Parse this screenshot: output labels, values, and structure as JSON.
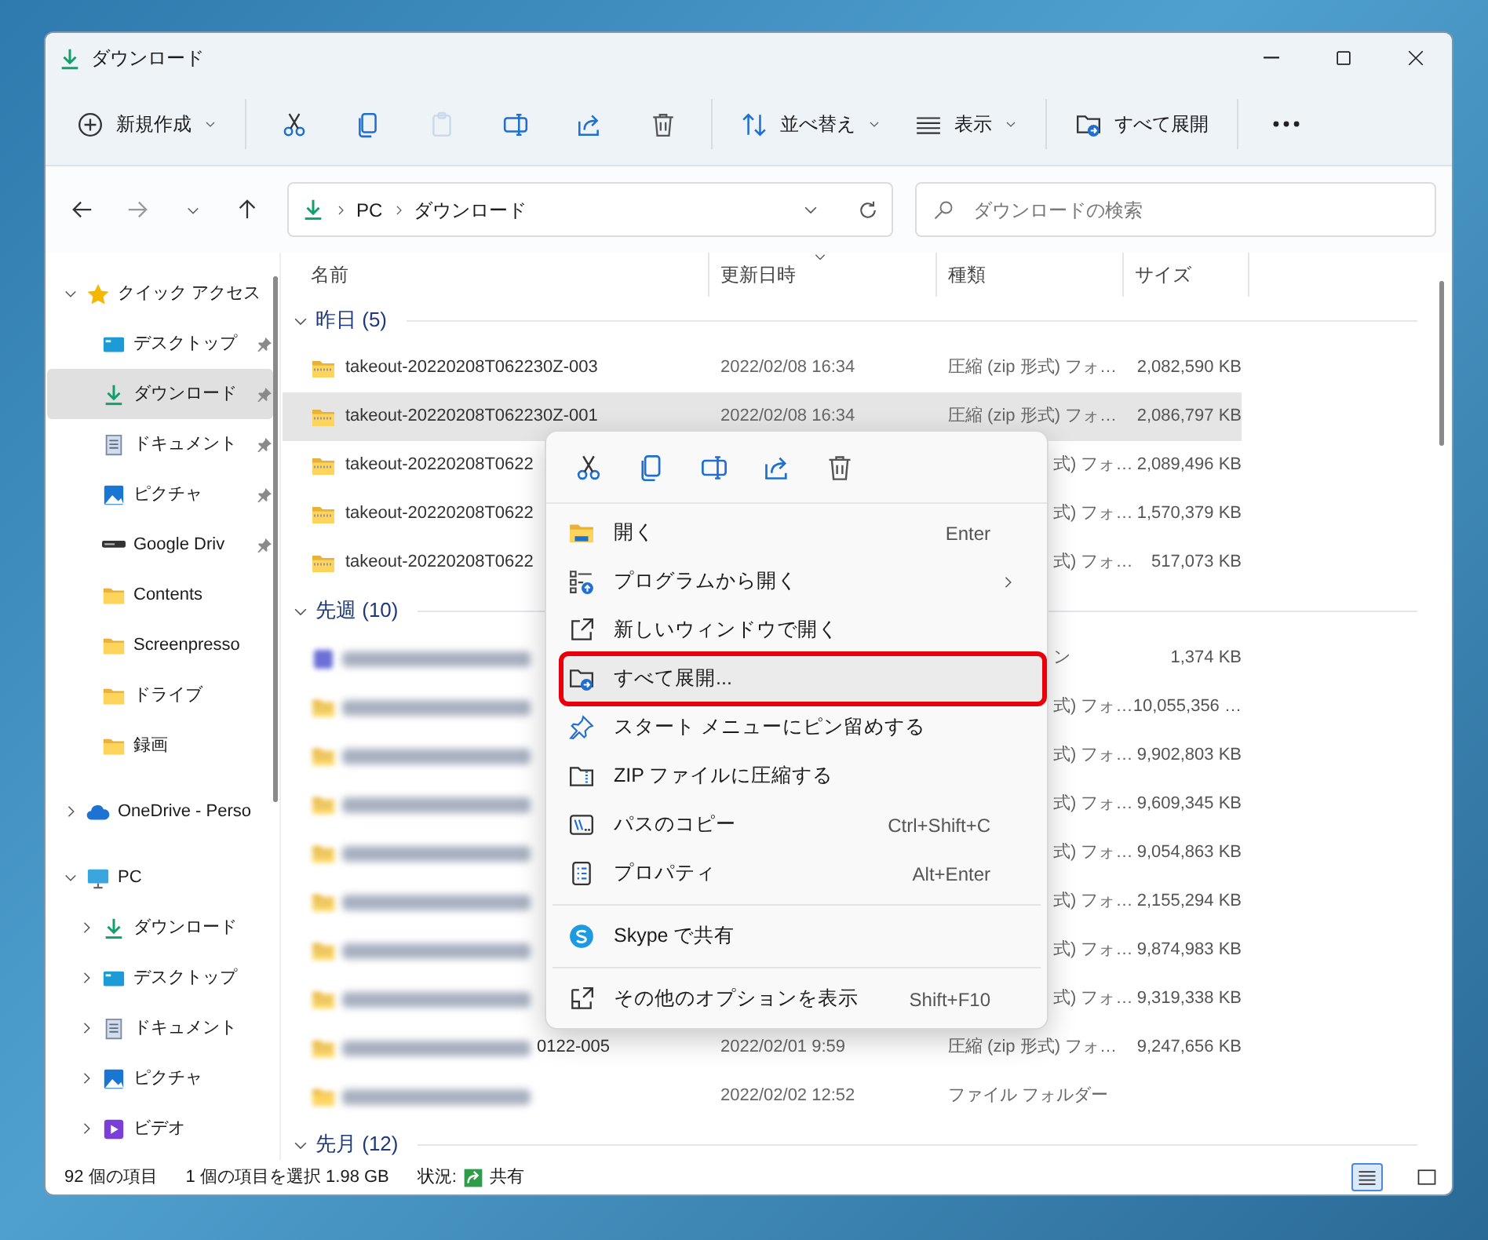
{
  "window": {
    "title": "ダウンロード"
  },
  "toolbar": [
    {
      "kind": "labeled",
      "label": "新規作成",
      "caret": true,
      "disabled": false
    },
    {
      "kind": "separator"
    },
    {
      "kind": "icon",
      "disabled": false
    },
    {
      "kind": "icon",
      "disabled": false
    },
    {
      "kind": "icon",
      "disabled": true
    },
    {
      "kind": "icon",
      "disabled": false
    },
    {
      "kind": "icon",
      "disabled": false
    },
    {
      "kind": "icon",
      "disabled": false
    },
    {
      "kind": "separator"
    },
    {
      "kind": "labeled",
      "label": "並べ替え",
      "caret": true,
      "disabled": false
    },
    {
      "kind": "labeled",
      "label": "表示",
      "caret": true,
      "disabled": false
    },
    {
      "kind": "separator"
    },
    {
      "kind": "labeled",
      "label": "すべて展開",
      "caret": false,
      "disabled": false
    },
    {
      "kind": "separator"
    },
    {
      "kind": "icon",
      "disabled": false
    }
  ],
  "address_bar": {
    "path": [
      "PC",
      "ダウンロード"
    ]
  },
  "search": {
    "placeholder": "ダウンロードの検索"
  },
  "sidebar": {
    "items": [
      {
        "kind": "quick-access",
        "label": "クイック アクセス",
        "expanded": true,
        "selected": false,
        "children": [
          {
            "kind": "desktop",
            "label": "デスクトップ",
            "pinned": true,
            "selected": false
          },
          {
            "kind": "download",
            "label": "ダウンロード",
            "pinned": true,
            "selected": true
          },
          {
            "kind": "documents",
            "label": "ドキュメント",
            "pinned": true,
            "selected": false
          },
          {
            "kind": "pictures",
            "label": "ピクチャ",
            "pinned": true,
            "selected": false
          },
          {
            "kind": "drive",
            "label": "Google Driv",
            "pinned": true,
            "selected": false
          },
          {
            "kind": "folder",
            "label": "Contents",
            "pinned": false,
            "selected": false
          },
          {
            "kind": "folder",
            "label": "Screenpresso",
            "pinned": false,
            "selected": false
          },
          {
            "kind": "folder",
            "label": "ドライブ",
            "pinned": false,
            "selected": false
          },
          {
            "kind": "folder",
            "label": "録画",
            "pinned": false,
            "selected": false
          }
        ]
      },
      {
        "kind": "onedrive",
        "label": "OneDrive - Perso",
        "expanded": false,
        "selected": false
      },
      {
        "kind": "pc",
        "label": "PC",
        "expanded": true,
        "selected": false,
        "children": [
          {
            "kind": "download",
            "label": "ダウンロード",
            "expanded": false,
            "selected": false
          },
          {
            "kind": "desktop",
            "label": "デスクトップ",
            "expanded": false,
            "selected": false
          },
          {
            "kind": "documents",
            "label": "ドキュメント",
            "expanded": false,
            "selected": false
          },
          {
            "kind": "pictures",
            "label": "ピクチャ",
            "expanded": false,
            "selected": false
          },
          {
            "kind": "videos",
            "label": "ビデオ",
            "expanded": false,
            "selected": false
          }
        ]
      }
    ]
  },
  "table": {
    "columns": [
      {
        "label": "名前",
        "sorted": false
      },
      {
        "label": "更新日時",
        "sorted": true
      },
      {
        "label": "種類",
        "sorted": false
      },
      {
        "label": "サイズ",
        "sorted": false
      }
    ],
    "groups": [
      {
        "label": "昨日 (5)",
        "expanded": true,
        "rows": [
          {
            "kind": "zip",
            "name": "takeout-20220208T062230Z-003",
            "date": "2022/02/08 16:34",
            "type": "圧縮 (zip 形式) フォ…",
            "size": "2,082,590 KB",
            "selected": false
          },
          {
            "kind": "zip",
            "name": "takeout-20220208T062230Z-001",
            "date": "2022/02/08 16:34",
            "type": "圧縮 (zip 形式) フォ…",
            "size": "2,086,797 KB",
            "selected": true
          },
          {
            "kind": "zip",
            "name": "takeout-20220208T0622",
            "type": "式) フォ…",
            "size": "2,089,496 KB",
            "covered": true,
            "selected": false
          },
          {
            "kind": "zip",
            "name": "takeout-20220208T0622",
            "type": "式) フォ…",
            "size": "1,570,379 KB",
            "covered": true,
            "selected": false
          },
          {
            "kind": "zip",
            "name": "takeout-20220208T0622",
            "type": "式) フォ…",
            "size": "517,073 KB",
            "covered": true,
            "selected": false
          }
        ]
      },
      {
        "label": "先週 (10)",
        "expanded": true,
        "rows": [
          {
            "kind": "file",
            "name_blurred": true,
            "type": "ン",
            "size": "1,374 KB",
            "covered": true,
            "selected": false
          },
          {
            "kind": "zip",
            "name_blurred": true,
            "type": "式) フォ…",
            "size": "10,055,356 …",
            "covered": true,
            "selected": false
          },
          {
            "kind": "zip",
            "name_blurred": true,
            "type": "式) フォ…",
            "size": "9,902,803 KB",
            "covered": true,
            "selected": false
          },
          {
            "kind": "zip",
            "name_blurred": true,
            "type": "式) フォ…",
            "size": "9,609,345 KB",
            "covered": true,
            "selected": false
          },
          {
            "kind": "zip",
            "name_blurred": true,
            "type": "式) フォ…",
            "size": "9,054,863 KB",
            "covered": true,
            "selected": false
          },
          {
            "kind": "zip",
            "name_blurred": true,
            "type": "式) フォ…",
            "size": "2,155,294 KB",
            "covered": true,
            "selected": false
          },
          {
            "kind": "zip",
            "name_blurred": true,
            "type": "式) フォ…",
            "size": "9,874,983 KB",
            "covered": true,
            "selected": false
          },
          {
            "kind": "zip",
            "name_blurred": true,
            "type": "式) フォ…",
            "size": "9,319,338 KB",
            "covered": true,
            "selected": false
          },
          {
            "kind": "zip",
            "name_blurred": true,
            "name": "0122-005",
            "date": "2022/02/01 9:59",
            "type": "圧縮 (zip 形式) フォ…",
            "size": "9,247,656 KB",
            "selected": false
          },
          {
            "kind": "folder",
            "name_blurred": true,
            "date": "2022/02/02 12:52",
            "type": "ファイル フォルダー",
            "selected": false
          }
        ]
      },
      {
        "label": "先月 (12)",
        "expanded": true
      }
    ]
  },
  "context_menu": {
    "actions": [
      {
        "disabled": false
      },
      {
        "disabled": false
      },
      {
        "disabled": false
      },
      {
        "disabled": false
      },
      {
        "disabled": false
      }
    ],
    "items": [
      {
        "kind": "item",
        "label": "開く",
        "shortcut": "Enter",
        "submenu": false,
        "highlighted": false
      },
      {
        "kind": "item",
        "label": "プログラムから開く",
        "submenu": true,
        "highlighted": false
      },
      {
        "kind": "item",
        "label": "新しいウィンドウで開く",
        "submenu": false,
        "highlighted": false
      },
      {
        "kind": "item",
        "label": "すべて展開...",
        "submenu": false,
        "highlighted": true
      },
      {
        "kind": "item",
        "label": "スタート メニューにピン留めする",
        "submenu": false,
        "highlighted": false
      },
      {
        "kind": "item",
        "label": "ZIP ファイルに圧縮する",
        "submenu": false,
        "highlighted": false
      },
      {
        "kind": "item",
        "label": "パスのコピー",
        "shortcut": "Ctrl+Shift+C",
        "submenu": false,
        "highlighted": false
      },
      {
        "kind": "item",
        "label": "プロパティ",
        "shortcut": "Alt+Enter",
        "submenu": false,
        "highlighted": false
      },
      {
        "kind": "separator"
      },
      {
        "kind": "item",
        "label": "Skype で共有",
        "submenu": false,
        "highlighted": false
      },
      {
        "kind": "separator"
      },
      {
        "kind": "item",
        "label": "その他のオプションを表示",
        "shortcut": "Shift+F10",
        "submenu": false,
        "highlighted": false
      }
    ]
  },
  "status_bar": {
    "item_count": "92 個の項目",
    "selection": "1 個の項目を選択 1.98 GB",
    "status_label": "状況:",
    "status_value": "共有",
    "views": [
      {
        "kind": "details",
        "selected": true
      },
      {
        "kind": "tiles",
        "selected": false
      }
    ]
  }
}
